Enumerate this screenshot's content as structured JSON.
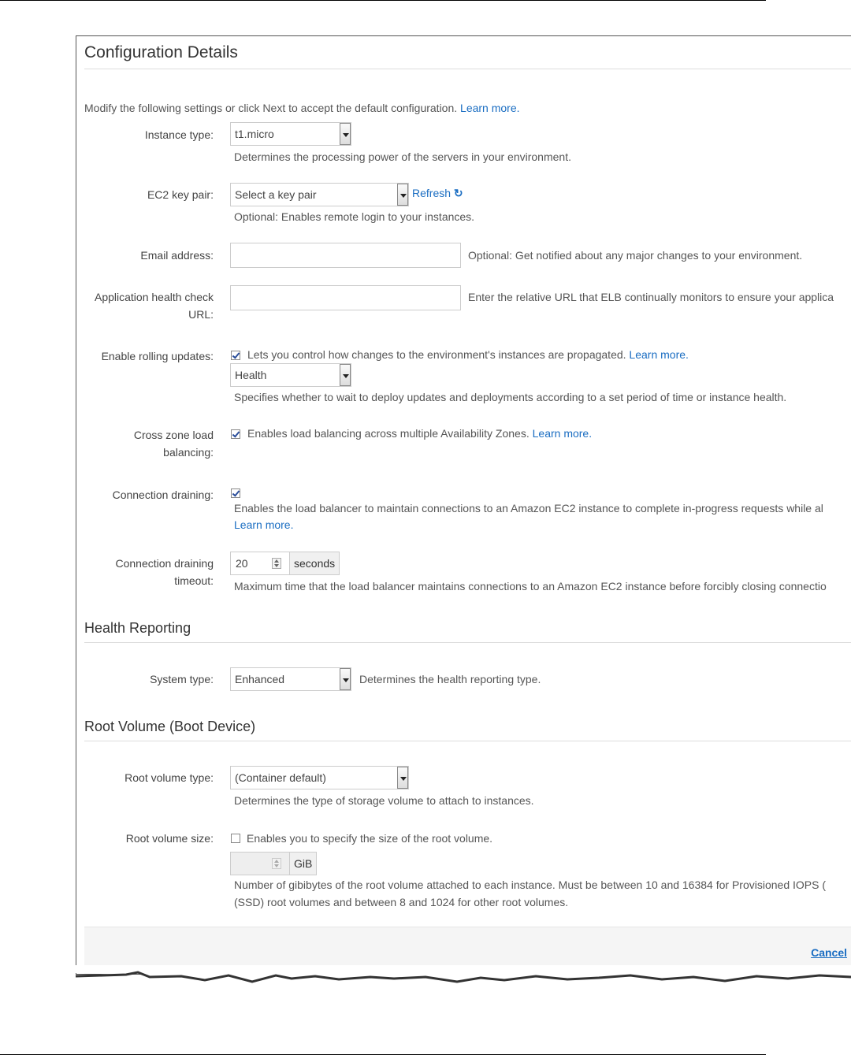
{
  "title": "Configuration Details",
  "intro": {
    "text": "Modify the following settings or click Next to accept the default configuration.",
    "link": "Learn more."
  },
  "instance_type": {
    "label": "Instance type:",
    "value": "t1.micro",
    "help": "Determines the processing power of the servers in your environment."
  },
  "key_pair": {
    "label": "EC2 key pair:",
    "value": "Select a key pair",
    "refresh": "Refresh",
    "help": "Optional: Enables remote login to your instances."
  },
  "email": {
    "label": "Email address:",
    "value": "",
    "help": "Optional: Get notified about any major changes to your environment."
  },
  "health_url": {
    "label_line1": "Application health check",
    "label_line2": "URL:",
    "value": "",
    "help": "Enter the relative URL that ELB continually monitors to ensure your applica"
  },
  "rolling": {
    "label": "Enable rolling updates:",
    "checked": true,
    "text": "Lets you control how changes to the environment's instances are propagated.",
    "link": "Learn more.",
    "select_value": "Health",
    "help": "Specifies whether to wait to deploy updates and deployments according to a set period of time or instance health."
  },
  "cross_zone": {
    "label_line1": "Cross zone load",
    "label_line2": "balancing:",
    "checked": true,
    "text": "Enables load balancing across multiple Availability Zones.",
    "link": "Learn more."
  },
  "draining": {
    "label": "Connection draining:",
    "checked": true,
    "text": "Enables the load balancer to maintain connections to an Amazon EC2 instance to complete in-progress requests while al",
    "link": "Learn more."
  },
  "draining_timeout": {
    "label_line1": "Connection draining",
    "label_line2": "timeout:",
    "value": "20",
    "unit": "seconds",
    "help": "Maximum time that the load balancer maintains connections to an Amazon EC2 instance before forcibly closing connectio"
  },
  "health_reporting": {
    "title": "Health Reporting",
    "label": "System type:",
    "value": "Enhanced",
    "help": "Determines the health reporting type."
  },
  "root_volume": {
    "title": "Root Volume (Boot Device)",
    "type_label": "Root volume type:",
    "type_value": "(Container default)",
    "type_help": "Determines the type of storage volume to attach to instances.",
    "size_label": "Root volume size:",
    "size_checked": false,
    "size_text": "Enables you to specify the size of the root volume.",
    "size_value": "",
    "size_unit": "GiB",
    "size_help_line1": "Number of gibibytes of the root volume attached to each instance. Must be between 10 and 16384 for Provisioned IOPS (",
    "size_help_line2": "(SSD) root volumes and between 8 and 1024 for other root volumes."
  },
  "footer": {
    "cancel": "Cancel"
  },
  "colors": {
    "link": "#1a6dc2",
    "border": "#cccccc",
    "text": "#444444"
  }
}
